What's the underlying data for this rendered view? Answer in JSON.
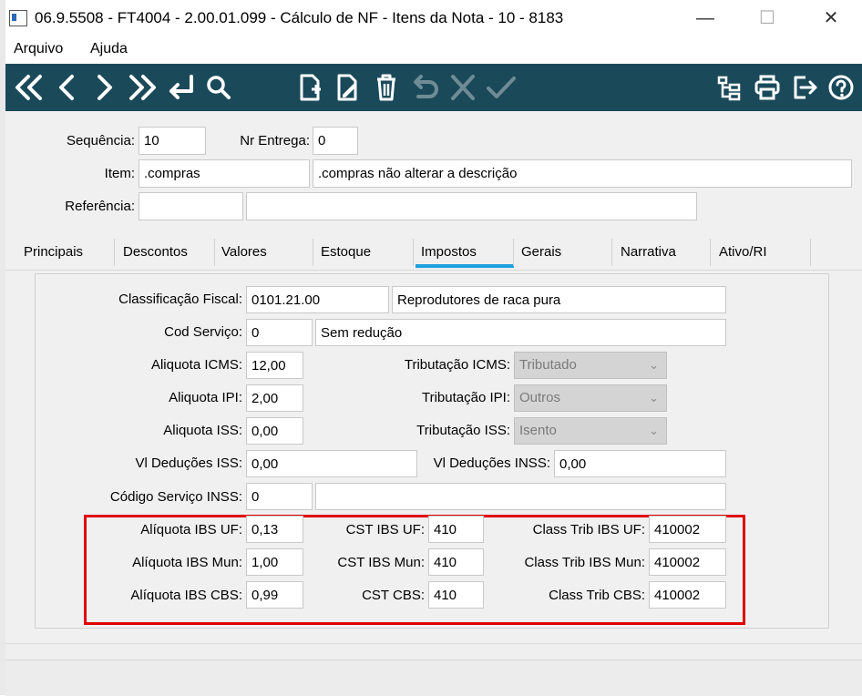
{
  "window": {
    "title": "06.9.5508 - FT4004 - 2.00.01.099 - Cálculo de NF - Itens da Nota - 10 - 8183",
    "minimize": "—",
    "maximize": "☐",
    "close": "✕"
  },
  "menu": {
    "file": "Arquivo",
    "help": "Ajuda"
  },
  "toolbar": {
    "icons": [
      "first-record-icon",
      "previous-record-icon",
      "next-record-icon",
      "last-record-icon",
      "return-icon",
      "search-icon",
      "new-document-icon",
      "edit-document-icon",
      "delete-icon",
      "undo-icon",
      "cancel-icon",
      "confirm-icon",
      "tree-icon",
      "print-icon",
      "exit-icon",
      "help-icon"
    ],
    "bg_color": "#1a4a5a"
  },
  "header": {
    "sequencia_label": "Sequência:",
    "sequencia_value": "10",
    "nr_entrega_label": "Nr Entrega:",
    "nr_entrega_value": "0",
    "item_label": "Item:",
    "item_code": ".compras",
    "item_desc": ".compras não alterar a descrição",
    "referencia_label": "Referência:",
    "referencia_code": "",
    "referencia_desc": ""
  },
  "tabs": [
    "Principais",
    "Descontos",
    "Valores",
    "Estoque",
    "Impostos",
    "Gerais",
    "Narrativa",
    "Ativo/RI"
  ],
  "active_tab": "Impostos",
  "impostos": {
    "class_fiscal_label": "Classificação Fiscal:",
    "class_fiscal_code": "0101.21.00",
    "class_fiscal_desc": "Reprodutores de raca pura",
    "cod_servico_label": "Cod Serviço:",
    "cod_servico_code": "0",
    "cod_servico_desc": "Sem redução",
    "aliq_icms_label": "Aliquota ICMS:",
    "aliq_icms_value": "12,00",
    "trib_icms_label": "Tributação ICMS:",
    "trib_icms_value": "Tributado",
    "aliq_ipi_label": "Aliquota IPI:",
    "aliq_ipi_value": "2,00",
    "trib_ipi_label": "Tributação IPI:",
    "trib_ipi_value": "Outros",
    "aliq_iss_label": "Aliquota ISS:",
    "aliq_iss_value": "0,00",
    "trib_iss_label": "Tributação ISS:",
    "trib_iss_value": "Isento",
    "vl_ded_iss_label": "Vl Deduções ISS:",
    "vl_ded_iss_value": "0,00",
    "vl_ded_inss_label": "Vl Deduções INSS:",
    "vl_ded_inss_value": "0,00",
    "cod_serv_inss_label": "Código Serviço INSS:",
    "cod_serv_inss_code": "0",
    "cod_serv_inss_desc": "",
    "aliq_ibs_uf_label": "Alíquota IBS UF:",
    "aliq_ibs_uf_value": "0,13",
    "cst_ibs_uf_label": "CST IBS UF:",
    "cst_ibs_uf_value": "410",
    "class_trib_ibs_uf_label": "Class Trib IBS UF:",
    "class_trib_ibs_uf_value": "410002",
    "aliq_ibs_mun_label": "Alíquota IBS Mun:",
    "aliq_ibs_mun_value": "1,00",
    "cst_ibs_mun_label": "CST IBS Mun:",
    "cst_ibs_mun_value": "410",
    "class_trib_ibs_mun_label": "Class Trib IBS Mun:",
    "class_trib_ibs_mun_value": "410002",
    "aliq_ibs_cbs_label": "Alíquota IBS CBS:",
    "aliq_ibs_cbs_value": "0,99",
    "cst_cbs_label": "CST CBS:",
    "cst_cbs_value": "410",
    "class_trib_cbs_label": "Class Trib CBS:",
    "class_trib_cbs_value": "410002"
  },
  "colors": {
    "highlight_border": "#e00000",
    "active_tab_underline": "#1ea0e0"
  }
}
